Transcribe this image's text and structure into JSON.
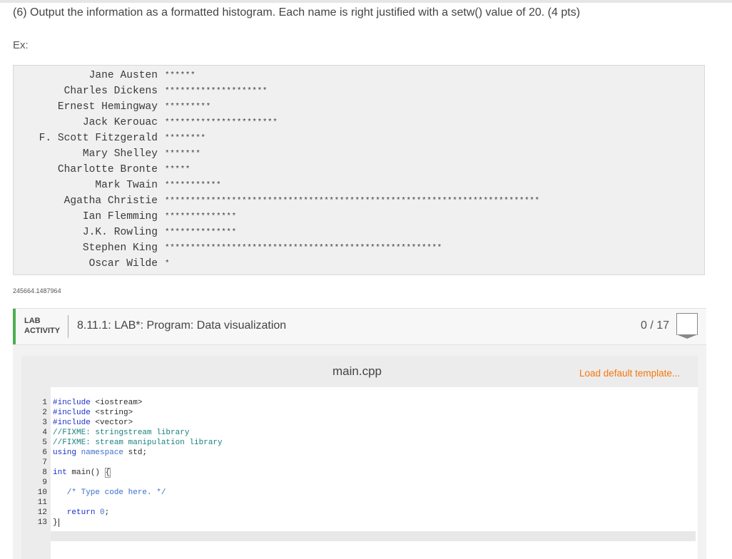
{
  "instructions": "(6) Output the information as a formatted histogram. Each name is right justified with a setw() value of 20. (4 pts)",
  "example_label": "Ex:",
  "histogram": [
    {
      "name": "Jane Austen",
      "stars": 6
    },
    {
      "name": "Charles Dickens",
      "stars": 20
    },
    {
      "name": "Ernest Hemingway",
      "stars": 9
    },
    {
      "name": "Jack Kerouac",
      "stars": 22
    },
    {
      "name": "F. Scott Fitzgerald",
      "stars": 8
    },
    {
      "name": "Mary Shelley",
      "stars": 7
    },
    {
      "name": "Charlotte Bronte",
      "stars": 5
    },
    {
      "name": "Mark Twain",
      "stars": 11
    },
    {
      "name": "Agatha Christie",
      "stars": 73
    },
    {
      "name": "Ian Flemming",
      "stars": 14
    },
    {
      "name": "J.K. Rowling",
      "stars": 14
    },
    {
      "name": "Stephen King",
      "stars": 54
    },
    {
      "name": "Oscar Wilde",
      "stars": 1
    }
  ],
  "footer_id": "245664.1487964",
  "lab": {
    "word1": "LAB",
    "word2": "ACTIVITY",
    "title": "8.11.1: LAB*: Program: Data visualization",
    "score": "0 / 17"
  },
  "editor": {
    "file_name": "main.cpp",
    "load_template": "Load default template...",
    "lines": [
      "#include <iostream>",
      "#include <string>",
      "#include <vector>",
      "//FIXME: stringstream library",
      "//FIXME: stream manipulation library",
      "using namespace std;",
      "",
      "int main() {",
      "",
      "   /* Type code here. */",
      "",
      "   return 0;",
      "}"
    ]
  },
  "colors": {
    "accent_green": "#4caf50",
    "link_orange": "#f5770b",
    "keyword_blue": "#1b2fc7",
    "comment_teal": "#1a8080"
  }
}
